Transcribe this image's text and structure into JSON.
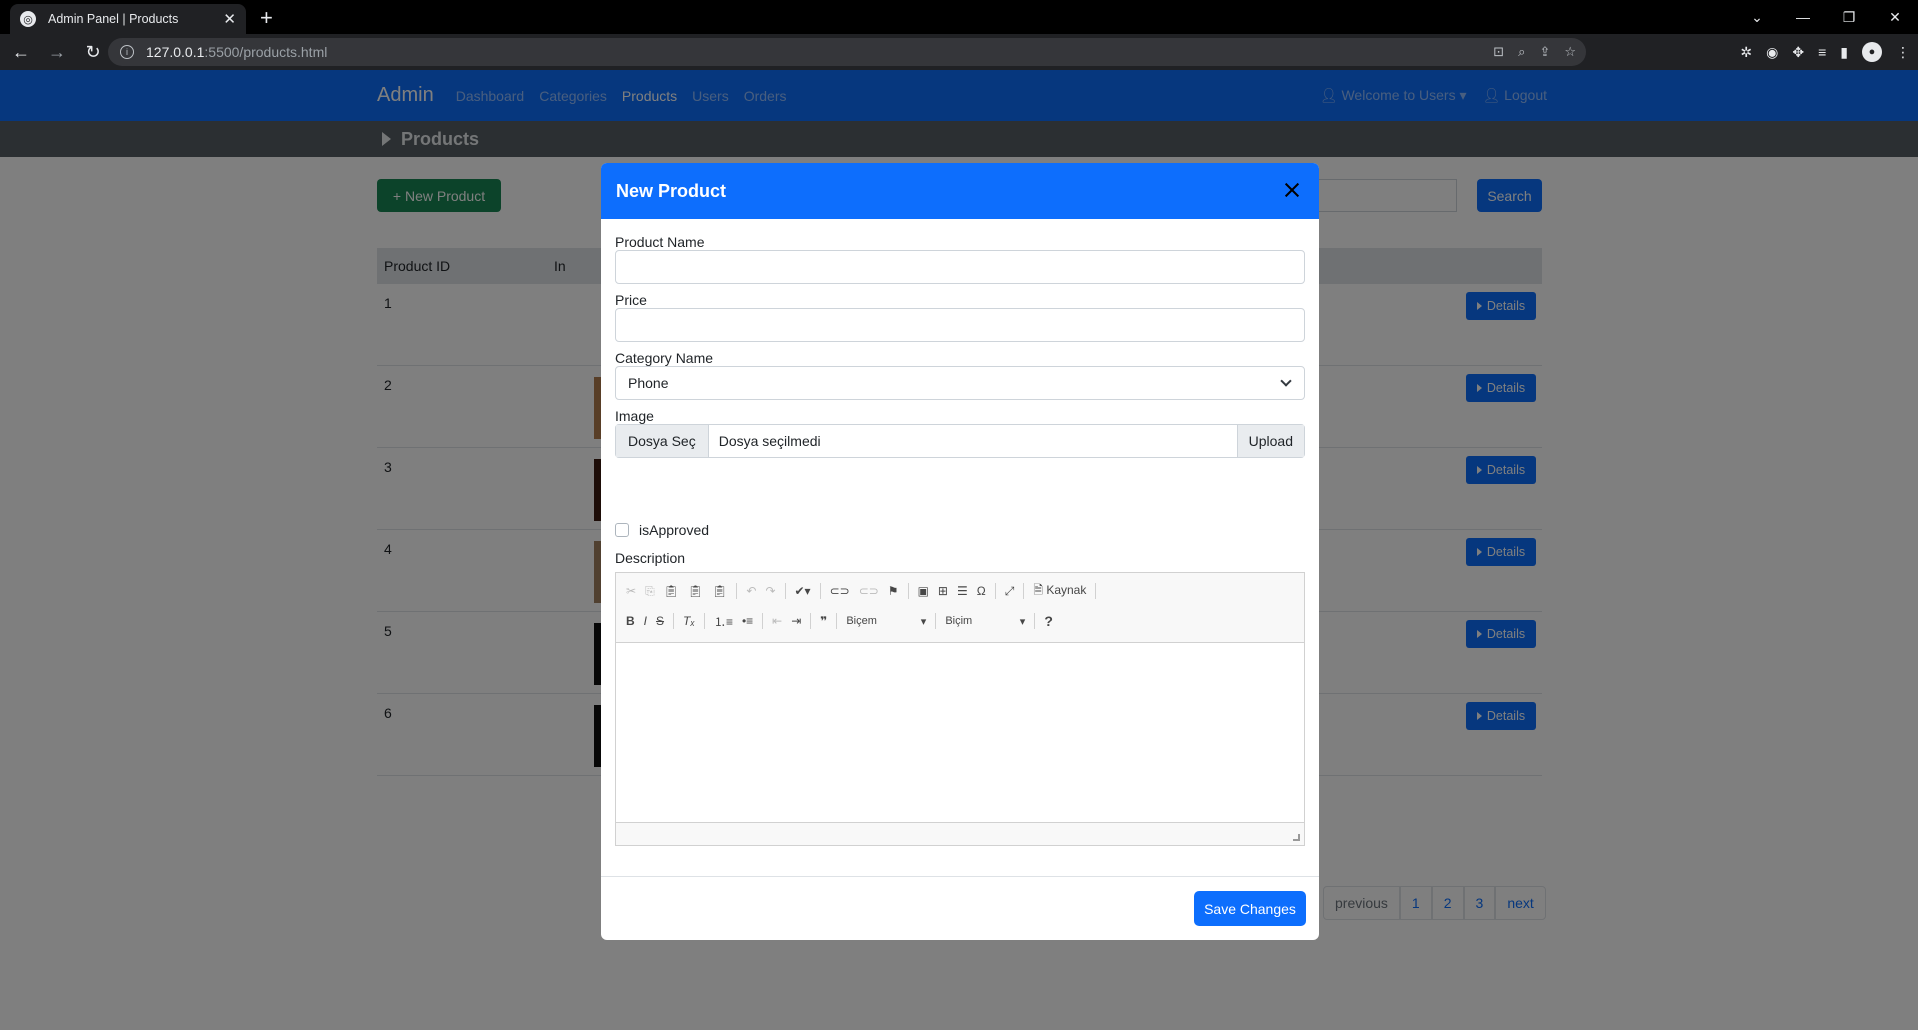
{
  "browser": {
    "tab_title": "Admin Panel | Products",
    "url_host": "127.0.0.1",
    "url_path": ":5500/products.html"
  },
  "nav": {
    "brand": "Admin",
    "links": [
      "Dashboard",
      "Categories",
      "Products",
      "Users",
      "Orders"
    ],
    "active": "Products",
    "welcome": "Welcome to Users",
    "logout": "Logout"
  },
  "page": {
    "title": "Products",
    "new_button": "+ New Product",
    "search_button": "Search"
  },
  "table": {
    "headers": [
      "Product ID",
      "In"
    ],
    "rows": [
      {
        "id": "1",
        "details": "Details"
      },
      {
        "id": "2",
        "details": "Details"
      },
      {
        "id": "3",
        "details": "Details"
      },
      {
        "id": "4",
        "details": "Details"
      },
      {
        "id": "5",
        "details": "Details"
      },
      {
        "id": "6",
        "details": "Details"
      }
    ]
  },
  "pagination": {
    "previous": "previous",
    "pages": [
      "1",
      "2",
      "3"
    ],
    "next": "next"
  },
  "modal": {
    "title": "New Product",
    "product_name_label": "Product Name",
    "product_name_value": "",
    "price_label": "Price",
    "price_value": "",
    "category_label": "Category Name",
    "category_value": "Phone",
    "image_label": "Image",
    "file_choose": "Dosya Seç",
    "file_name": "Dosya seçilmedi",
    "upload": "Upload",
    "approved_label": "isApproved",
    "description_label": "Description",
    "editor": {
      "source": "Kaynak",
      "styles_combo": "Biçem",
      "format_combo": "Biçim"
    },
    "save_button": "Save Changes"
  }
}
